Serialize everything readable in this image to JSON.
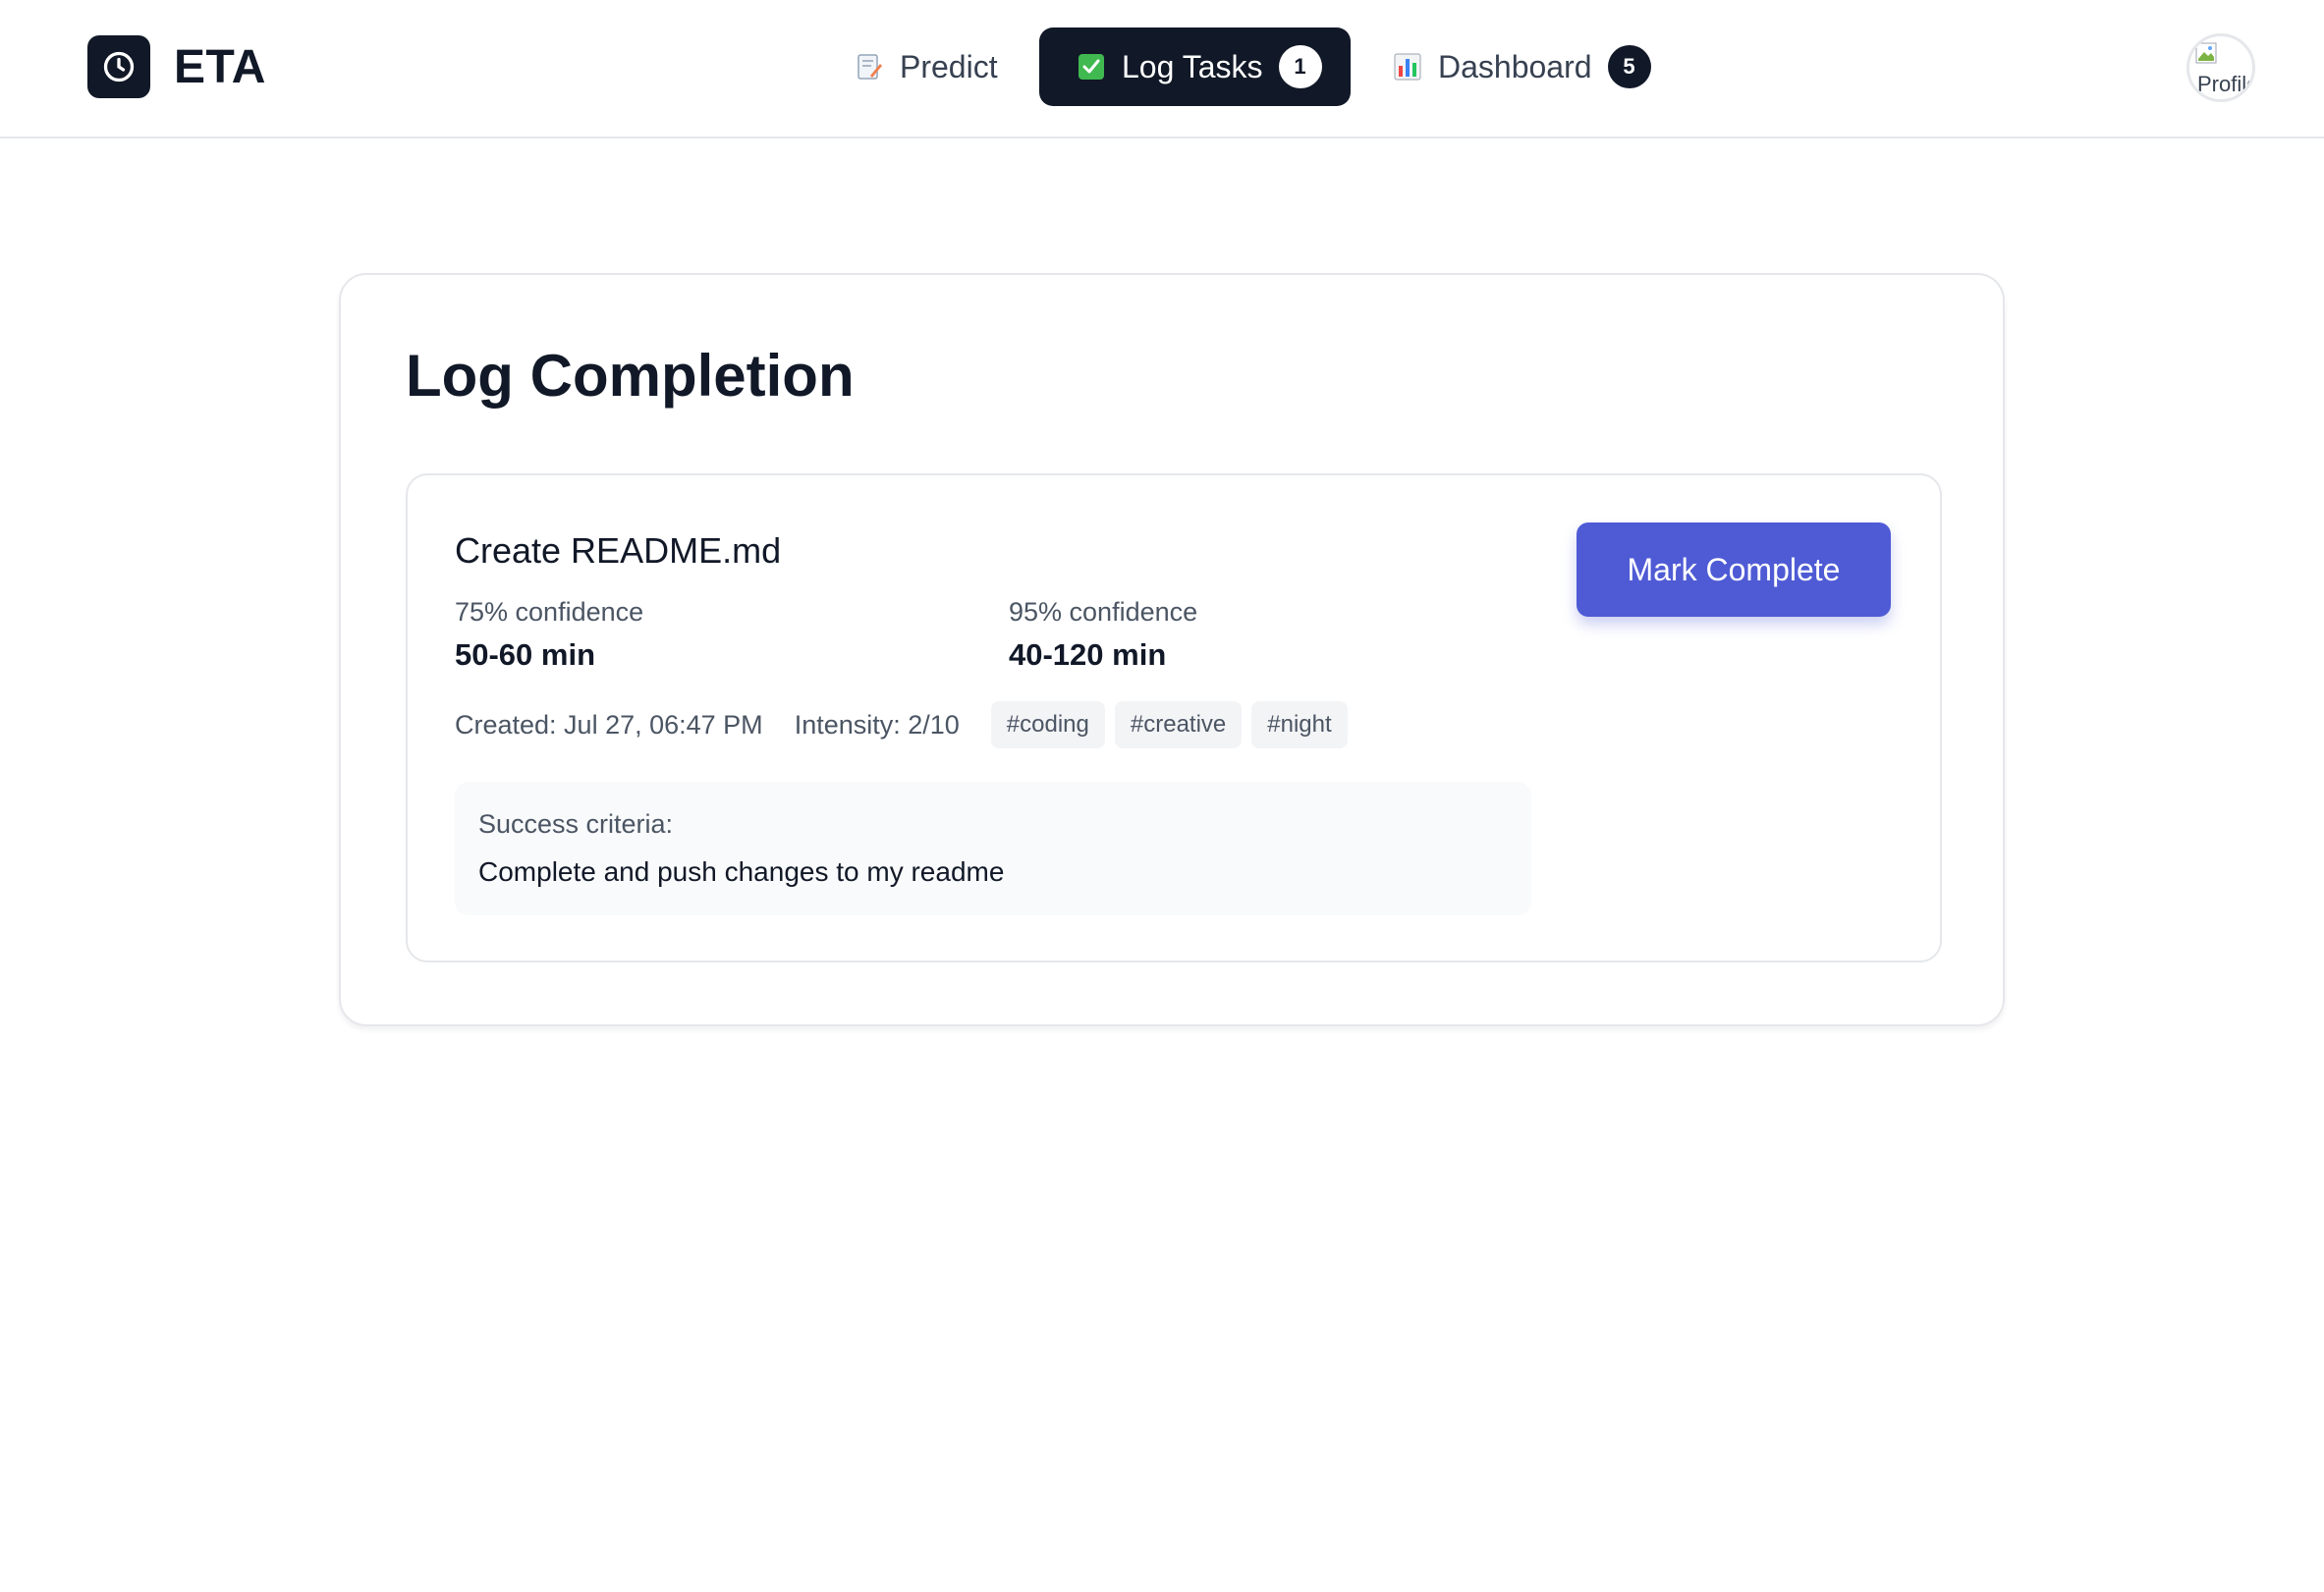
{
  "app": {
    "name": "ETA",
    "logo_icon": "clock-icon"
  },
  "nav": {
    "items": [
      {
        "label": "Predict",
        "icon": "memo-icon",
        "active": false
      },
      {
        "label": "Log Tasks",
        "icon": "check-box-icon",
        "active": true,
        "badge": "1"
      },
      {
        "label": "Dashboard",
        "icon": "bar-chart-icon",
        "active": false,
        "badge": "5"
      }
    ]
  },
  "profile": {
    "avatar_alt": "Profile"
  },
  "main": {
    "title": "Log Completion",
    "task": {
      "title": "Create README.md",
      "confidence_75_label": "75% confidence",
      "confidence_75_value": "50-60 min",
      "confidence_95_label": "95% confidence",
      "confidence_95_value": "40-120 min",
      "created": "Created: Jul 27, 06:47 PM",
      "intensity": "Intensity: 2/10",
      "tags": [
        "#coding",
        "#creative",
        "#night"
      ],
      "criteria_label": "Success criteria:",
      "criteria_text": "Complete and push changes to my readme",
      "action_label": "Mark Complete"
    }
  },
  "colors": {
    "primary_dark": "#111827",
    "accent": "#4f5bd5",
    "muted_text": "#4b5563",
    "border": "#e5e7eb"
  }
}
